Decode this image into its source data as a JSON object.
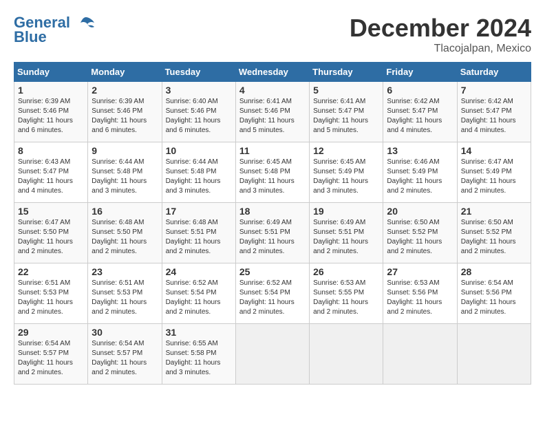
{
  "header": {
    "logo_line1": "General",
    "logo_line2": "Blue",
    "month": "December 2024",
    "location": "Tlacojalpan, Mexico"
  },
  "weekdays": [
    "Sunday",
    "Monday",
    "Tuesday",
    "Wednesday",
    "Thursday",
    "Friday",
    "Saturday"
  ],
  "weeks": [
    [
      {
        "day": 1,
        "sunrise": "6:39 AM",
        "sunset": "5:46 PM",
        "daylight": "11 hours and 6 minutes."
      },
      {
        "day": 2,
        "sunrise": "6:39 AM",
        "sunset": "5:46 PM",
        "daylight": "11 hours and 6 minutes."
      },
      {
        "day": 3,
        "sunrise": "6:40 AM",
        "sunset": "5:46 PM",
        "daylight": "11 hours and 6 minutes."
      },
      {
        "day": 4,
        "sunrise": "6:41 AM",
        "sunset": "5:46 PM",
        "daylight": "11 hours and 5 minutes."
      },
      {
        "day": 5,
        "sunrise": "6:41 AM",
        "sunset": "5:47 PM",
        "daylight": "11 hours and 5 minutes."
      },
      {
        "day": 6,
        "sunrise": "6:42 AM",
        "sunset": "5:47 PM",
        "daylight": "11 hours and 4 minutes."
      },
      {
        "day": 7,
        "sunrise": "6:42 AM",
        "sunset": "5:47 PM",
        "daylight": "11 hours and 4 minutes."
      }
    ],
    [
      {
        "day": 8,
        "sunrise": "6:43 AM",
        "sunset": "5:47 PM",
        "daylight": "11 hours and 4 minutes."
      },
      {
        "day": 9,
        "sunrise": "6:44 AM",
        "sunset": "5:48 PM",
        "daylight": "11 hours and 3 minutes."
      },
      {
        "day": 10,
        "sunrise": "6:44 AM",
        "sunset": "5:48 PM",
        "daylight": "11 hours and 3 minutes."
      },
      {
        "day": 11,
        "sunrise": "6:45 AM",
        "sunset": "5:48 PM",
        "daylight": "11 hours and 3 minutes."
      },
      {
        "day": 12,
        "sunrise": "6:45 AM",
        "sunset": "5:49 PM",
        "daylight": "11 hours and 3 minutes."
      },
      {
        "day": 13,
        "sunrise": "6:46 AM",
        "sunset": "5:49 PM",
        "daylight": "11 hours and 2 minutes."
      },
      {
        "day": 14,
        "sunrise": "6:47 AM",
        "sunset": "5:49 PM",
        "daylight": "11 hours and 2 minutes."
      }
    ],
    [
      {
        "day": 15,
        "sunrise": "6:47 AM",
        "sunset": "5:50 PM",
        "daylight": "11 hours and 2 minutes."
      },
      {
        "day": 16,
        "sunrise": "6:48 AM",
        "sunset": "5:50 PM",
        "daylight": "11 hours and 2 minutes."
      },
      {
        "day": 17,
        "sunrise": "6:48 AM",
        "sunset": "5:51 PM",
        "daylight": "11 hours and 2 minutes."
      },
      {
        "day": 18,
        "sunrise": "6:49 AM",
        "sunset": "5:51 PM",
        "daylight": "11 hours and 2 minutes."
      },
      {
        "day": 19,
        "sunrise": "6:49 AM",
        "sunset": "5:51 PM",
        "daylight": "11 hours and 2 minutes."
      },
      {
        "day": 20,
        "sunrise": "6:50 AM",
        "sunset": "5:52 PM",
        "daylight": "11 hours and 2 minutes."
      },
      {
        "day": 21,
        "sunrise": "6:50 AM",
        "sunset": "5:52 PM",
        "daylight": "11 hours and 2 minutes."
      }
    ],
    [
      {
        "day": 22,
        "sunrise": "6:51 AM",
        "sunset": "5:53 PM",
        "daylight": "11 hours and 2 minutes."
      },
      {
        "day": 23,
        "sunrise": "6:51 AM",
        "sunset": "5:53 PM",
        "daylight": "11 hours and 2 minutes."
      },
      {
        "day": 24,
        "sunrise": "6:52 AM",
        "sunset": "5:54 PM",
        "daylight": "11 hours and 2 minutes."
      },
      {
        "day": 25,
        "sunrise": "6:52 AM",
        "sunset": "5:54 PM",
        "daylight": "11 hours and 2 minutes."
      },
      {
        "day": 26,
        "sunrise": "6:53 AM",
        "sunset": "5:55 PM",
        "daylight": "11 hours and 2 minutes."
      },
      {
        "day": 27,
        "sunrise": "6:53 AM",
        "sunset": "5:56 PM",
        "daylight": "11 hours and 2 minutes."
      },
      {
        "day": 28,
        "sunrise": "6:54 AM",
        "sunset": "5:56 PM",
        "daylight": "11 hours and 2 minutes."
      }
    ],
    [
      {
        "day": 29,
        "sunrise": "6:54 AM",
        "sunset": "5:57 PM",
        "daylight": "11 hours and 2 minutes."
      },
      {
        "day": 30,
        "sunrise": "6:54 AM",
        "sunset": "5:57 PM",
        "daylight": "11 hours and 2 minutes."
      },
      {
        "day": 31,
        "sunrise": "6:55 AM",
        "sunset": "5:58 PM",
        "daylight": "11 hours and 3 minutes."
      },
      null,
      null,
      null,
      null
    ]
  ]
}
